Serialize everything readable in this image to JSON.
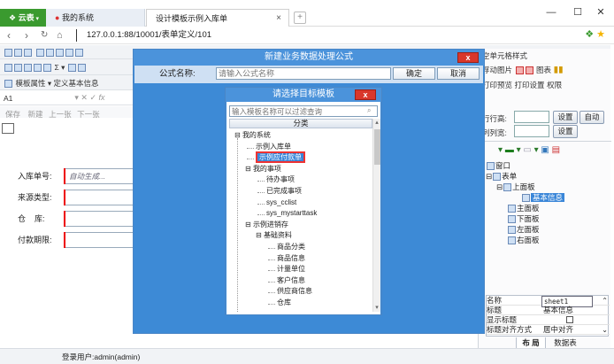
{
  "browser": {
    "tab_yunbiao": "云表",
    "tab_mysys": "我的系统",
    "tab_design": "设计模板示例入库单",
    "tab_close": "×",
    "tab_new": "+",
    "address": "127.0.0.1:88/10001/表单定义/101",
    "win_min": "—",
    "win_max": "☐",
    "win_close": "✕"
  },
  "toolbar": {
    "row3_left": "模板属性 ▾  定义基本信息",
    "row4_cell": "A1",
    "row5_items": [
      "保存",
      "新建",
      "上一张",
      "下一张"
    ],
    "right_row1": "空单元格样式",
    "right_row2": [
      "浮动图片",
      "图表"
    ],
    "right_row3": [
      "打印预览",
      "打印设置",
      "权限"
    ]
  },
  "form": {
    "fields": [
      {
        "label": "入库单号:",
        "value": "自动生成..."
      },
      {
        "label": "来源类型:",
        "value": ""
      },
      {
        "label": "仓    库:",
        "value": ""
      },
      {
        "label": "付款期限:",
        "value": ""
      }
    ]
  },
  "right_panel": {
    "row_height_label": "行行高:",
    "col_width_label": "列列宽:",
    "set_label": "设置",
    "auto_label": "自动",
    "tree": [
      {
        "label": "窗口",
        "level": 0
      },
      {
        "label": "表单",
        "level": 0
      },
      {
        "label": "上面板",
        "level": 1
      },
      {
        "label": "基本信息",
        "level": 2,
        "selected": true
      },
      {
        "label": "主面板",
        "level": 1
      },
      {
        "label": "下面板",
        "level": 1
      },
      {
        "label": "左面板",
        "level": 1
      },
      {
        "label": "右面板",
        "level": 1
      }
    ],
    "props": [
      {
        "k": "名称",
        "v": "sheet1"
      },
      {
        "k": "标题",
        "v": "基本信息"
      },
      {
        "k": "显示标题",
        "v": ""
      },
      {
        "k": "标题对齐方式",
        "v": "居中对齐"
      }
    ],
    "bottom_tabs": [
      "布 局",
      "数据表"
    ]
  },
  "dialog_formula": {
    "title": "新建业务数据处理公式",
    "close": "x",
    "name_label": "公式名称:",
    "name_placeholder": "请输入公式名称",
    "ok": "确定",
    "cancel": "取消"
  },
  "dialog_template": {
    "title": "请选择目标模板",
    "close": "x",
    "search_placeholder": "输入模板名称可以过滤查询",
    "column_header": "分类",
    "nodes": [
      {
        "label": "我的系统",
        "indent": 0,
        "toggle": "⊟"
      },
      {
        "label": "示例入库单",
        "indent": 1
      },
      {
        "label": "示例应付款单",
        "indent": 1,
        "selected": true
      },
      {
        "label": "我的事项",
        "indent": 1,
        "toggle": "⊟"
      },
      {
        "label": "待办事项",
        "indent": 2
      },
      {
        "label": "已完成事项",
        "indent": 2
      },
      {
        "label": "sys_cclist",
        "indent": 2
      },
      {
        "label": "sys_mystarttask",
        "indent": 2
      },
      {
        "label": "示例进销存",
        "indent": 1,
        "toggle": "⊟"
      },
      {
        "label": "基础资料",
        "indent": 2,
        "toggle": "⊟"
      },
      {
        "label": "商品分类",
        "indent": 3
      },
      {
        "label": "商品信息",
        "indent": 3
      },
      {
        "label": "计量单位",
        "indent": 3
      },
      {
        "label": "客户信息",
        "indent": 3
      },
      {
        "label": "供应商信息",
        "indent": 3
      },
      {
        "label": "仓库",
        "indent": 3
      }
    ]
  },
  "status": {
    "user": "登录用户:admin(admin)"
  }
}
